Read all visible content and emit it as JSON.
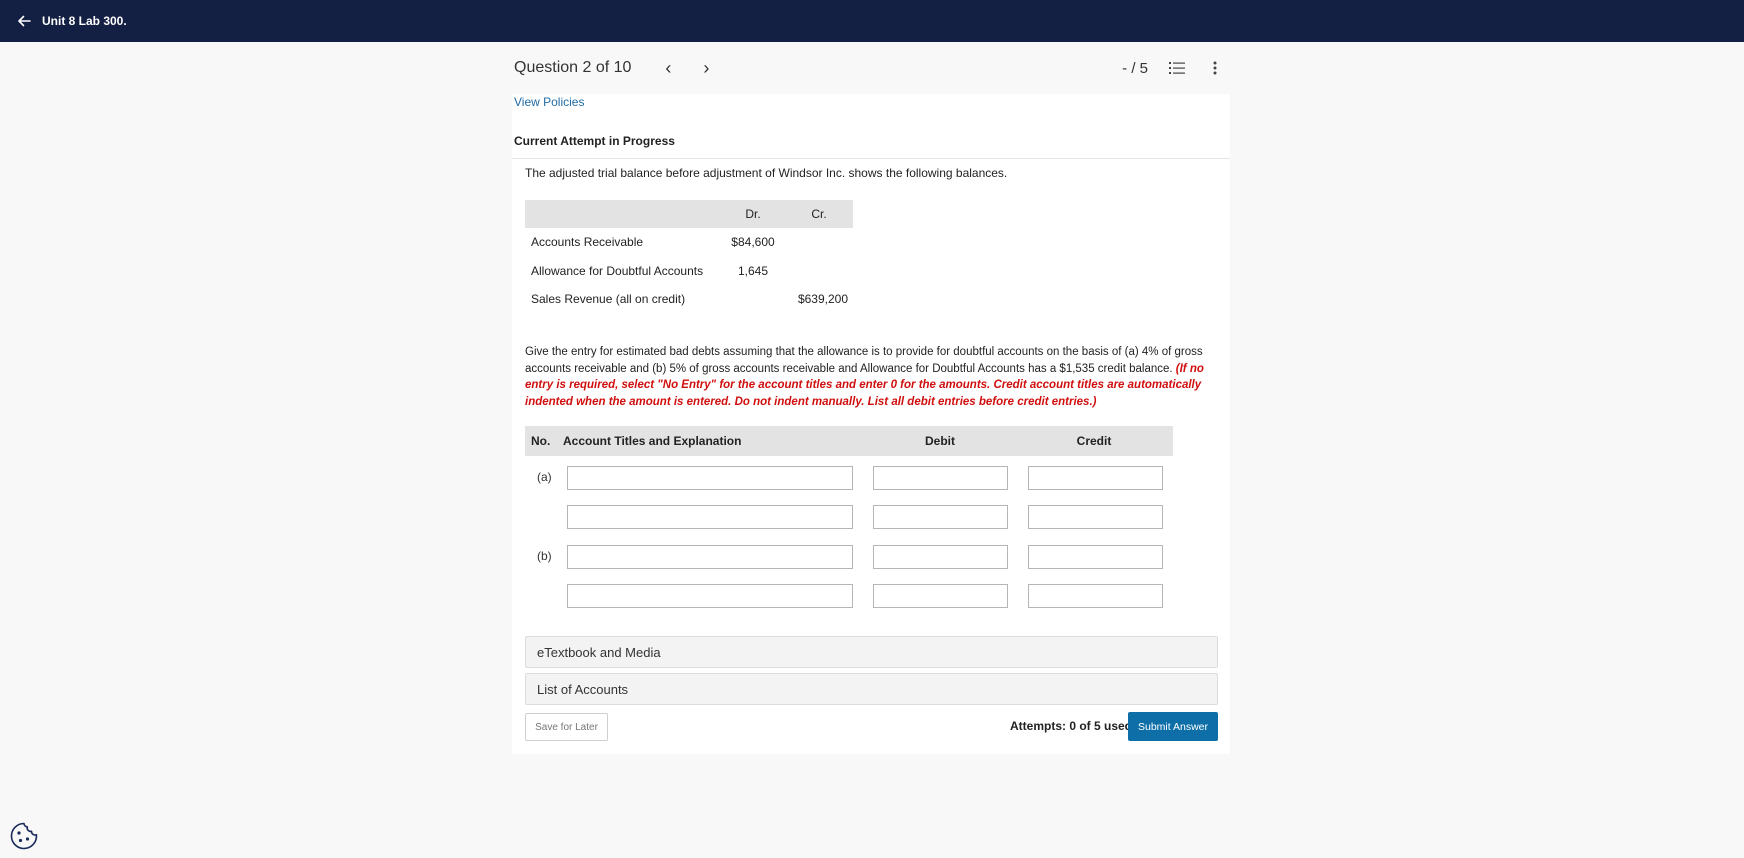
{
  "topbar": {
    "title": "Unit 8 Lab 300.",
    "back_icon": "arrow-left-icon"
  },
  "question_header": {
    "label": "Question 2 of 10",
    "prev_symbol": "‹",
    "next_symbol": "›",
    "score": "- / 5"
  },
  "links": {
    "view_policies": "View Policies"
  },
  "attempt_status": "Current Attempt in Progress",
  "problem": {
    "intro": "The adjusted trial balance before adjustment of Windsor Inc. shows the following balances.",
    "trial_balance": {
      "headers": {
        "account": "",
        "dr": "Dr.",
        "cr": "Cr."
      },
      "rows": [
        {
          "account": "Accounts Receivable",
          "dr": "$84,600",
          "cr": ""
        },
        {
          "account": "Allowance for Doubtful Accounts",
          "dr": "1,645",
          "cr": ""
        },
        {
          "account": "Sales Revenue (all on credit)",
          "dr": "",
          "cr": "$639,200"
        }
      ]
    },
    "instruction_text": "Give the entry for estimated bad debts assuming that the allowance is to provide for doubtful accounts on the basis of (a) 4% of gross accounts receivable and (b) 5% of gross accounts receivable and Allowance for Doubtful Accounts has a $1,535 credit balance. ",
    "instruction_note": "(If no entry is required, select \"No Entry\" for the account titles and enter 0 for the amounts. Credit account titles are automatically indented when the amount is entered. Do not indent manually. List all debit entries before credit entries.)"
  },
  "journal": {
    "headers": {
      "no": "No.",
      "account": "Account Titles and Explanation",
      "debit": "Debit",
      "credit": "Credit"
    },
    "rows": [
      {
        "label": "(a)",
        "account": "",
        "debit": "",
        "credit": ""
      },
      {
        "label": "",
        "account": "",
        "debit": "",
        "credit": ""
      },
      {
        "label": "(b)",
        "account": "",
        "debit": "",
        "credit": ""
      },
      {
        "label": "",
        "account": "",
        "debit": "",
        "credit": ""
      }
    ]
  },
  "accordions": {
    "etextbook": "eTextbook and Media",
    "accounts": "List of Accounts"
  },
  "footer": {
    "save_label": "Save for Later",
    "attempts": "Attempts: 0 of 5 used",
    "submit_label": "Submit Answer"
  },
  "colors": {
    "topbar": "#141f44",
    "link": "#1f6aa5",
    "note_red": "#d00f0f",
    "submit": "#0e6fa8",
    "cookie": "#1a2a5a"
  }
}
